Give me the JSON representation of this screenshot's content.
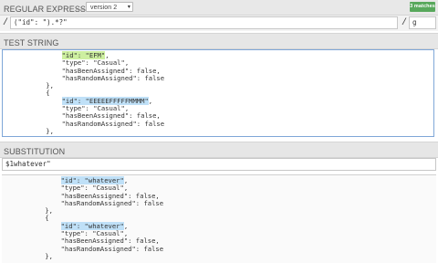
{
  "regex_panel": {
    "title": "REGULAR EXPRESSION",
    "separator": "—",
    "flavor": "version 2",
    "flavor_arrow": "▾",
    "matches": "3 matches",
    "open_delim": "/",
    "pattern": "(\"id\": \").*?\"",
    "close_delim": "/",
    "flags": "g"
  },
  "test_panel": {
    "title": "TEST STRING",
    "lines": [
      [
        "              ",
        {
          "t": "\"id\": \"EFM\"",
          "c": "g"
        },
        ","
      ],
      [
        "              \"type\": \"Casual\","
      ],
      [
        "              \"hasBeenAssigned\": false,"
      ],
      [
        "              \"hasRandomAssigned\": false"
      ],
      [
        "          },"
      ],
      [
        "          {"
      ],
      [
        "              ",
        {
          "t": "\"id\": \"EEEEEFFFFFMMMM\"",
          "c": "b"
        },
        ","
      ],
      [
        "              \"type\": \"Casual\","
      ],
      [
        "              \"hasBeenAssigned\": false,"
      ],
      [
        "              \"hasRandomAssigned\": false"
      ],
      [
        "          },"
      ]
    ]
  },
  "substitution_panel": {
    "title": "SUBSTITUTION",
    "value": "$1whatever\"",
    "lines": [
      [
        "              ",
        {
          "t": "\"id\": \"whatever\"",
          "c": "b"
        },
        ","
      ],
      [
        "              \"type\": \"Casual\","
      ],
      [
        "              \"hasBeenAssigned\": false,"
      ],
      [
        "              \"hasRandomAssigned\": false"
      ],
      [
        "          },"
      ],
      [
        "          {"
      ],
      [
        "              ",
        {
          "t": "\"id\": \"whatever\"",
          "c": "b"
        },
        ","
      ],
      [
        "              \"type\": \"Casual\","
      ],
      [
        "              \"hasBeenAssigned\": false,"
      ],
      [
        "              \"hasRandomAssigned\": false"
      ],
      [
        "          },"
      ]
    ]
  }
}
